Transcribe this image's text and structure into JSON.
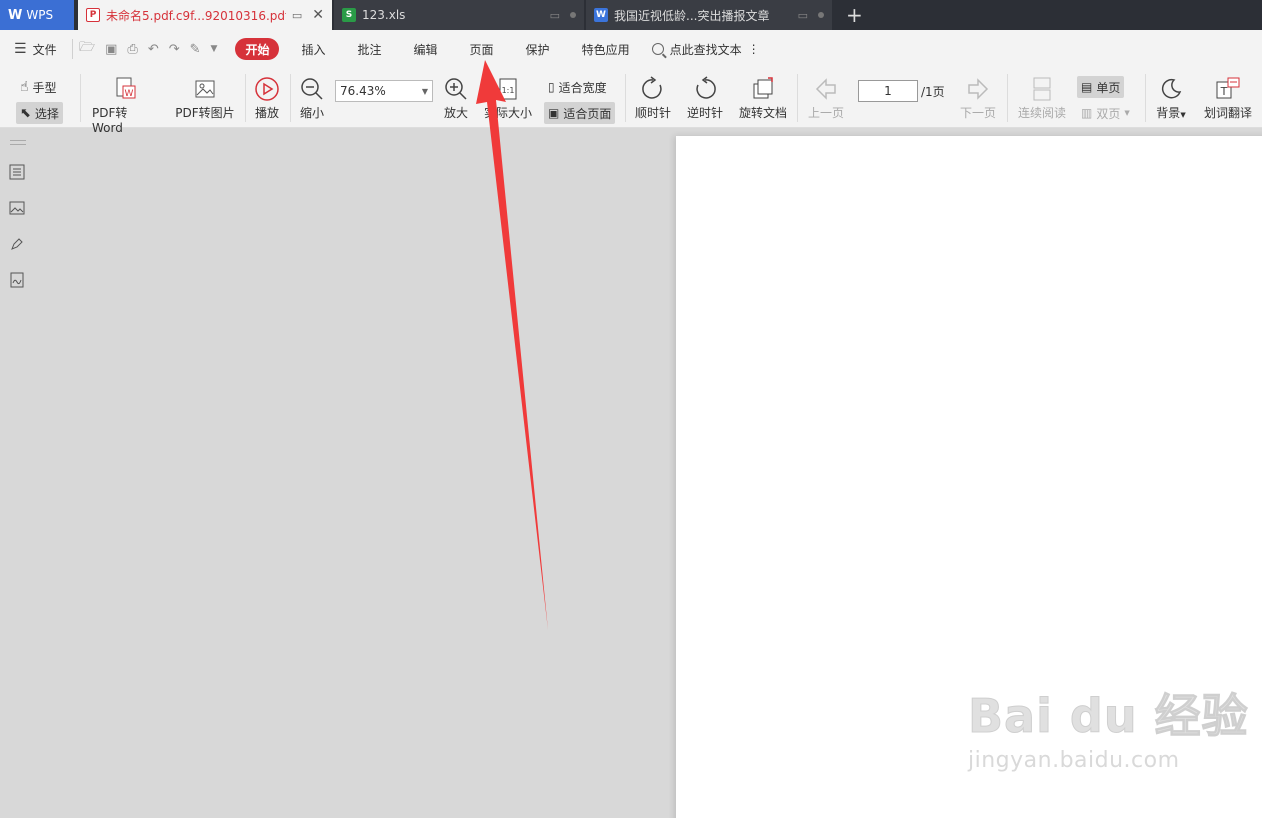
{
  "tabs": {
    "wps": "WPS",
    "active_pdf": "未命名5.pdf.c9f...92010316.pdf",
    "xls": "123.xls",
    "doc": "我国近视低龄...突出播报文章",
    "new_tab": "+"
  },
  "menu": {
    "file": "文件",
    "items": [
      "开始",
      "插入",
      "批注",
      "编辑",
      "页面",
      "保护",
      "特色应用"
    ],
    "search_placeholder": "点此查找文本",
    "more": "⋮"
  },
  "ribbon": {
    "hand": "手型",
    "select": "选择",
    "pdf_to_word": "PDF转Word",
    "pdf_to_image": "PDF转图片",
    "play": "播放",
    "zoom_out": "缩小",
    "zoom_value": "76.43%",
    "zoom_in": "放大",
    "actual_size": "实际大小",
    "fit_width": "适合宽度",
    "fit_page": "适合页面",
    "rotate_cw": "顺时针",
    "rotate_ccw": "逆时针",
    "rotate_doc": "旋转文档",
    "prev_page": "上一页",
    "page_current": "1",
    "page_total": "/1页",
    "next_page": "下一页",
    "continuous": "连续阅读",
    "single": "单页",
    "double": "双页",
    "background": "背景",
    "translate": "划词翻译"
  },
  "watermark": {
    "main": "Bai du 经验",
    "sub": "jingyan.baidu.com"
  },
  "colors": {
    "accent_red": "#d6323a",
    "tab_bar": "#2c2f36",
    "wps_blue": "#3b6fd4",
    "arrow": "#f03a3a"
  }
}
